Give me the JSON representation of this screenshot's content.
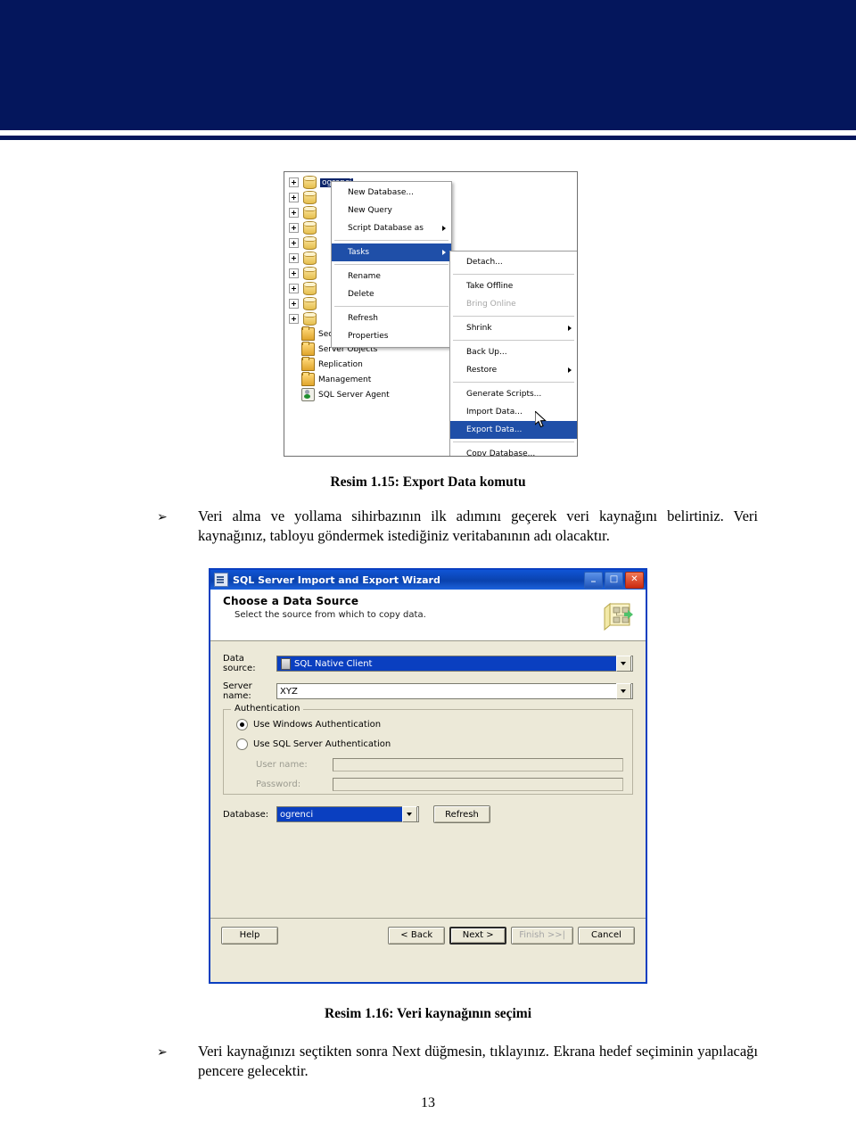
{
  "document": {
    "page_number": "13"
  },
  "figure1": {
    "name": "Export Data komutu",
    "tree": {
      "items": [
        {
          "label": "ogrenci",
          "icon": "database-icon",
          "expandable": true,
          "selected": true
        },
        {
          "label": "",
          "icon": "database-icon",
          "expandable": true,
          "selected": false
        },
        {
          "label": "",
          "icon": "database-icon",
          "expandable": true,
          "selected": false
        },
        {
          "label": "",
          "icon": "database-icon",
          "expandable": true,
          "selected": false
        },
        {
          "label": "",
          "icon": "database-icon",
          "expandable": true,
          "selected": false
        },
        {
          "label": "",
          "icon": "database-icon",
          "expandable": true,
          "selected": false
        },
        {
          "label": "",
          "icon": "database-icon",
          "expandable": true,
          "selected": false
        },
        {
          "label": "",
          "icon": "database-icon",
          "expandable": true,
          "selected": false
        },
        {
          "label": "",
          "icon": "database-icon",
          "expandable": true,
          "selected": false
        },
        {
          "label": "",
          "icon": "database-icon",
          "expandable": true,
          "selected": false
        },
        {
          "label": "Security",
          "icon": "folder-icon",
          "expandable": false,
          "selected": false
        },
        {
          "label": "Server Objects",
          "icon": "folder-icon",
          "expandable": false,
          "selected": false
        },
        {
          "label": "Replication",
          "icon": "folder-icon",
          "expandable": false,
          "selected": false
        },
        {
          "label": "Management",
          "icon": "folder-icon",
          "expandable": false,
          "selected": false
        },
        {
          "label": "SQL Server Agent",
          "icon": "agent-icon",
          "expandable": false,
          "selected": false
        }
      ]
    },
    "context_menu": {
      "items": [
        {
          "label": "New Database...",
          "submenu": false,
          "highlighted": false,
          "disabled": false
        },
        {
          "label": "New Query",
          "submenu": false,
          "highlighted": false,
          "disabled": false
        },
        {
          "label": "Script Database as",
          "submenu": true,
          "highlighted": false,
          "disabled": false
        },
        {
          "separator": true
        },
        {
          "label": "Tasks",
          "submenu": true,
          "highlighted": true,
          "disabled": false
        },
        {
          "separator": true
        },
        {
          "label": "Rename",
          "submenu": false,
          "highlighted": false,
          "disabled": false
        },
        {
          "label": "Delete",
          "submenu": false,
          "highlighted": false,
          "disabled": false
        },
        {
          "separator": true
        },
        {
          "label": "Refresh",
          "submenu": false,
          "highlighted": false,
          "disabled": false
        },
        {
          "label": "Properties",
          "submenu": false,
          "highlighted": false,
          "disabled": false
        }
      ]
    },
    "submenu": {
      "items": [
        {
          "label": "Detach...",
          "submenu": false,
          "highlighted": false,
          "disabled": false
        },
        {
          "separator": true
        },
        {
          "label": "Take Offline",
          "submenu": false,
          "highlighted": false,
          "disabled": false
        },
        {
          "label": "Bring Online",
          "submenu": false,
          "highlighted": false,
          "disabled": true
        },
        {
          "separator": true
        },
        {
          "label": "Shrink",
          "submenu": true,
          "highlighted": false,
          "disabled": false
        },
        {
          "separator": true
        },
        {
          "label": "Back Up...",
          "submenu": false,
          "highlighted": false,
          "disabled": false
        },
        {
          "label": "Restore",
          "submenu": true,
          "highlighted": false,
          "disabled": false
        },
        {
          "separator": true
        },
        {
          "label": "Generate Scripts...",
          "submenu": false,
          "highlighted": false,
          "disabled": false
        },
        {
          "label": "Import Data...",
          "submenu": false,
          "highlighted": false,
          "disabled": false
        },
        {
          "label": "Export Data...",
          "submenu": false,
          "highlighted": true,
          "disabled": false
        },
        {
          "separator": true
        },
        {
          "label": "Copy Database...",
          "submenu": false,
          "highlighted": false,
          "disabled": false
        }
      ]
    }
  },
  "caption1": "Resim 1.15: Export Data komutu",
  "paragraph1": {
    "bullet": "➢",
    "text": "Veri alma ve yollama sihirbazının ilk adımını geçerek veri kaynağını belirtiniz. Veri kaynağınız, tabloyu göndermek istediğiniz veritabanının adı olacaktır."
  },
  "figure2": {
    "titlebar": {
      "title": "SQL Server Import and Export Wizard",
      "icon": "wizard-window-icon",
      "minimize_glyph": "_",
      "maximize_glyph": "□",
      "close_glyph": "✕"
    },
    "header": {
      "heading": "Choose a Data Source",
      "subheading": "Select the source from which to copy data.",
      "icon": "data-source-icon"
    },
    "fields": {
      "data_source_label": "Data source:",
      "data_source_value": "SQL Native Client",
      "server_name_label": "Server name:",
      "server_name_value": "XYZ",
      "database_label": "Database:",
      "database_value": "ogrenci",
      "refresh_label": "Refresh"
    },
    "authentication": {
      "group_title": "Authentication",
      "windows_auth_label": "Use Windows Authentication",
      "windows_auth_selected": true,
      "sql_auth_label": "Use SQL Server Authentication",
      "sql_auth_selected": false,
      "user_name_label": "User name:",
      "user_name_value": "",
      "password_label": "Password:",
      "password_value": ""
    },
    "footer": {
      "help_label": "Help",
      "back_label": "< Back",
      "next_label": "Next >",
      "finish_label": "Finish >>|",
      "cancel_label": "Cancel"
    }
  },
  "caption2": "Resim 1.16: Veri kaynağının seçimi",
  "paragraph2": {
    "bullet": "➢",
    "text": "Veri kaynağınızı seçtikten sonra Next düğmesin, tıklayınız. Ekrana hedef seçiminin yapılacağı pencere gelecektir."
  },
  "colors": {
    "banner_navy": "#04165c",
    "menu_highlight": "#1f4fa8",
    "dialog_face": "#ece9d8",
    "titlebar_blue": "#0a42ad",
    "selection_blue": "#0a3fc0"
  }
}
